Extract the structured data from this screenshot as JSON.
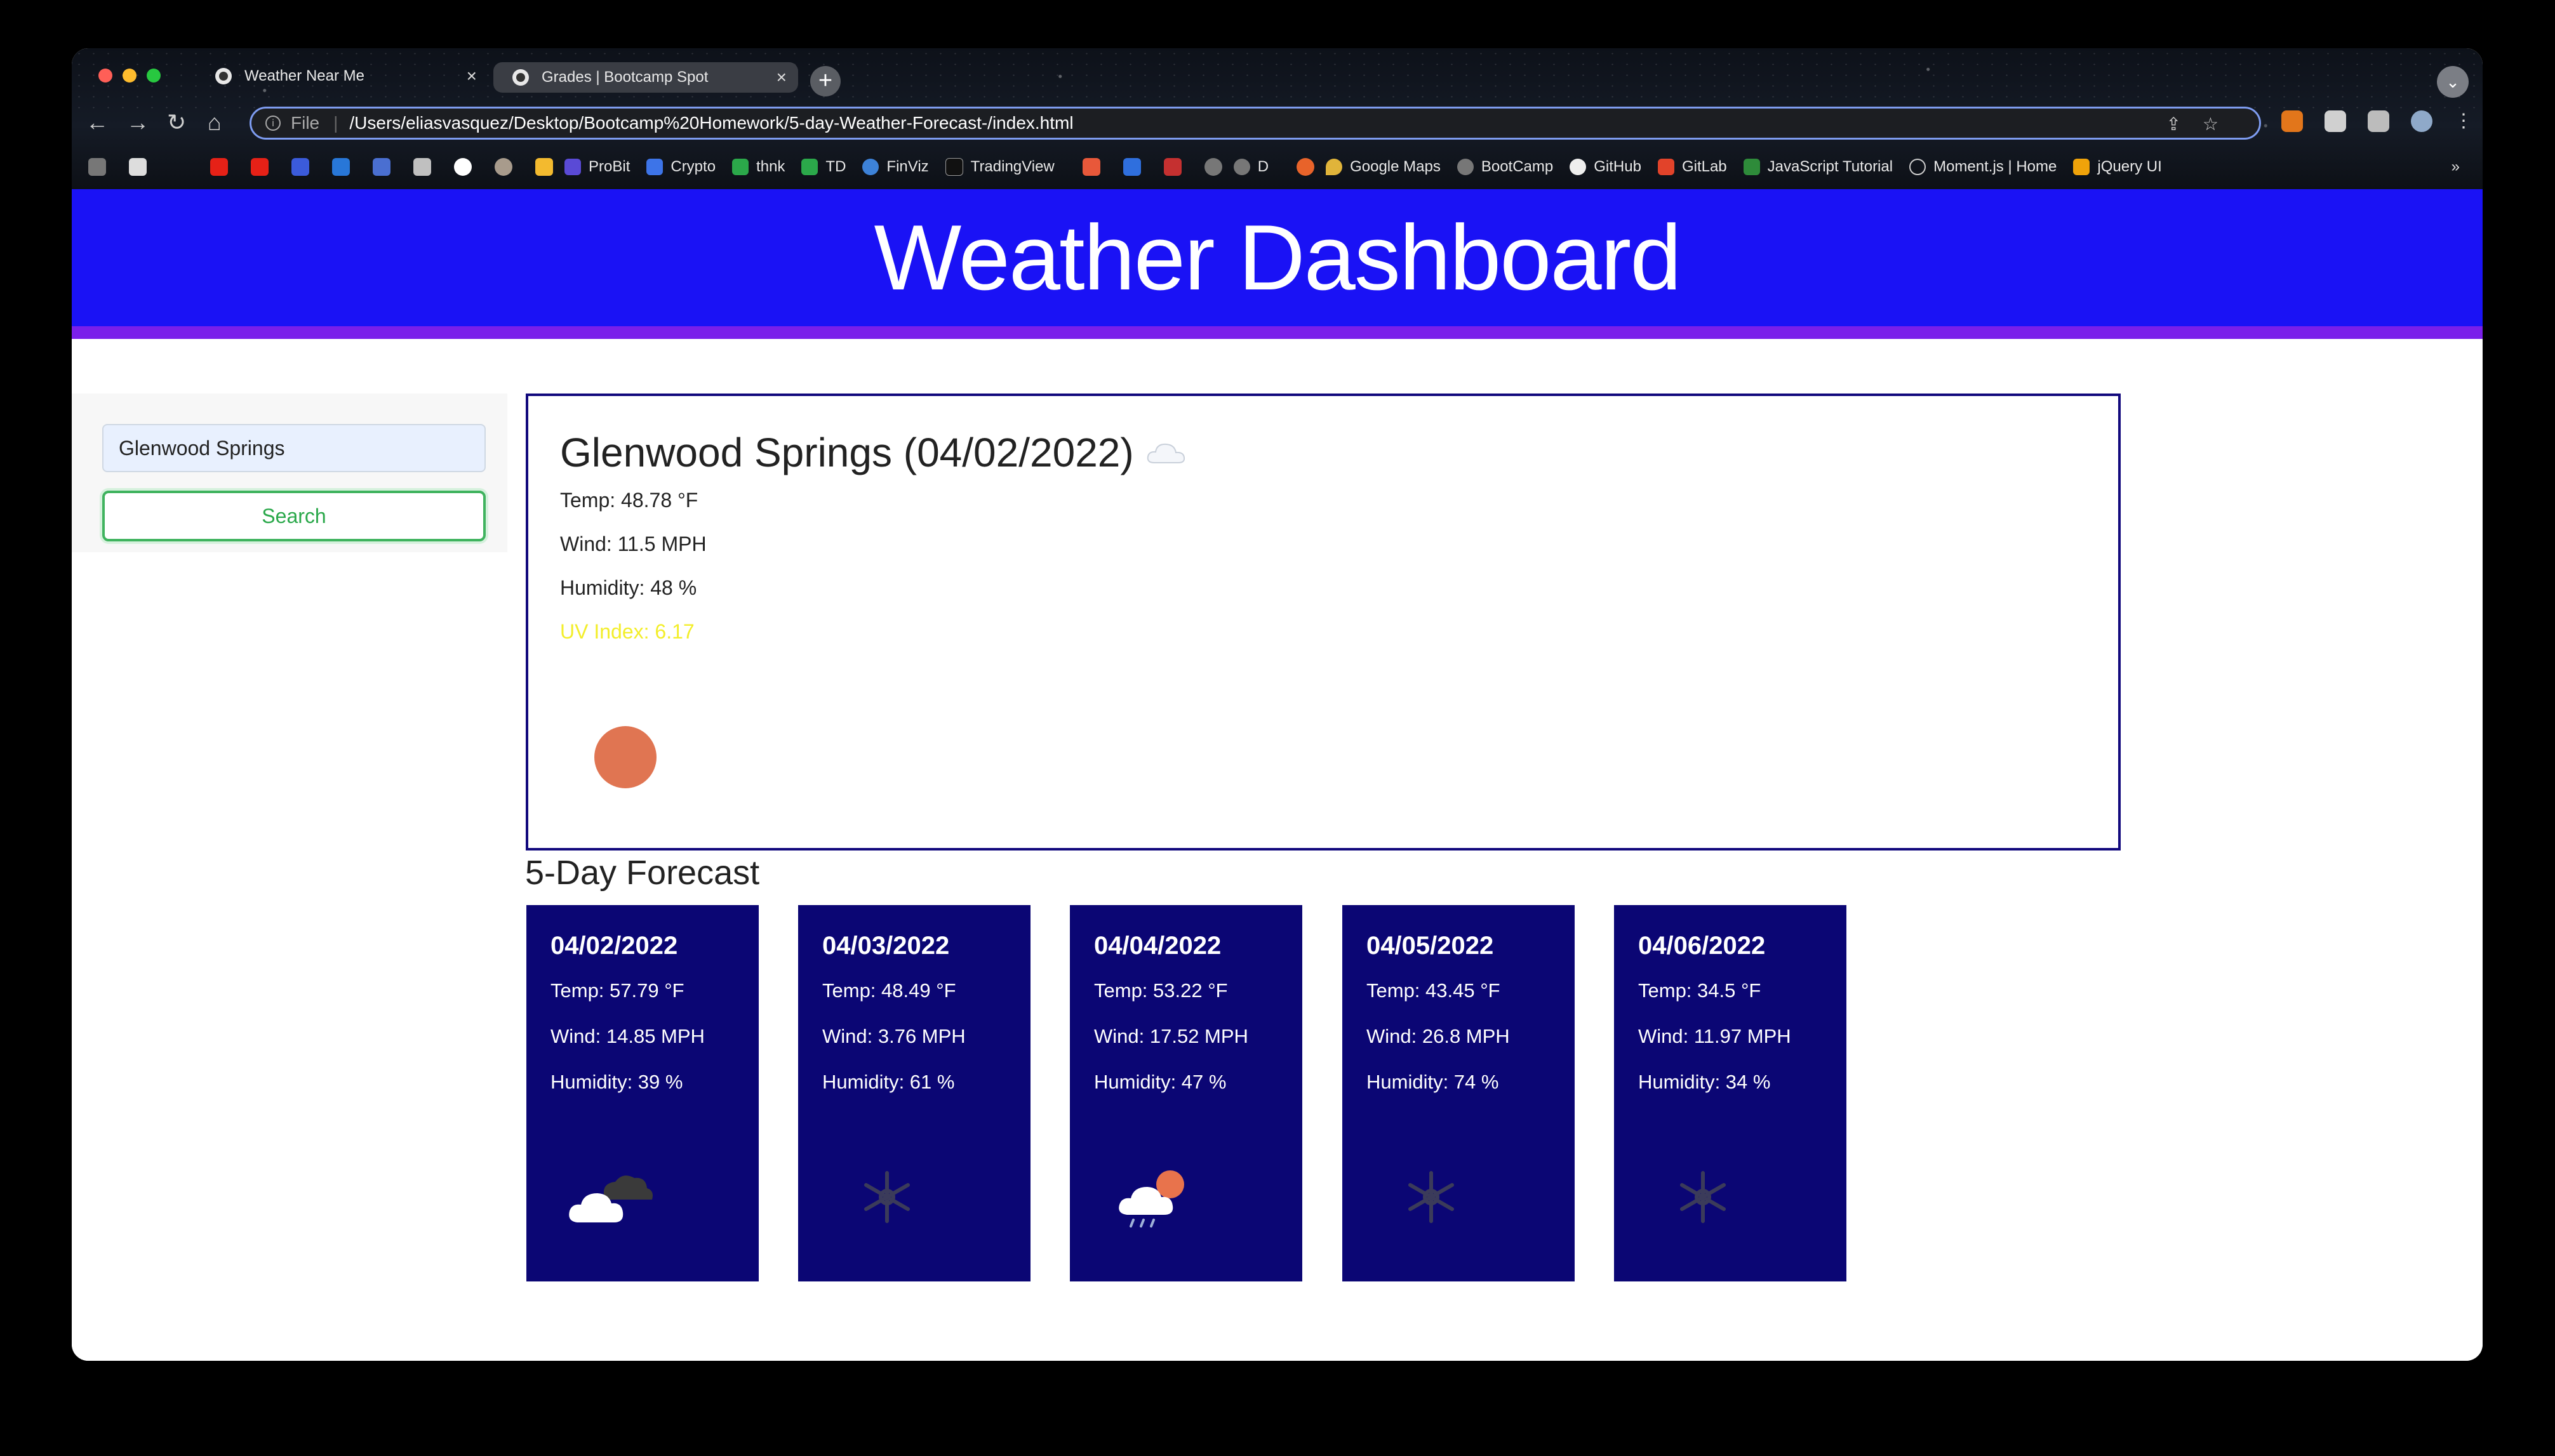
{
  "browser": {
    "tabs": [
      {
        "title": "Weather Near Me"
      },
      {
        "title": "Grades | Bootcamp Spot"
      }
    ],
    "address": {
      "scheme_label": "File",
      "url": "/Users/eliasvasquez/Desktop/Bootcamp%20Homework/5-day-Weather-Forecast-/index.html"
    },
    "bookmarks": [
      "ProBit",
      "Crypto",
      "thnk",
      "TD",
      "FinViz",
      "TradingView",
      "D",
      "Google Maps",
      "BootCamp",
      "GitHub",
      "GitLab",
      "JavaScript Tutorial",
      "Moment.js | Home",
      "jQuery UI"
    ],
    "more_bookmarks": "»"
  },
  "header": {
    "title": "Weather Dashboard"
  },
  "search": {
    "value": "Glenwood Springs",
    "button_label": "Search"
  },
  "current": {
    "title": "Glenwood Springs (04/02/2022)",
    "icon": "cloud-icon",
    "temp": "Temp: 48.78 °F",
    "wind": "Wind: 11.5 MPH",
    "humidity": "Humidity: 48 %",
    "uv": "UV Index: 6.17",
    "uv_color": "#e07552"
  },
  "forecast": {
    "title": "5-Day Forecast",
    "days": [
      {
        "date": "04/02/2022",
        "temp": "Temp: 57.79 °F",
        "wind": "Wind: 14.85 MPH",
        "humidity": "Humidity: 39 %",
        "icon": "broken-clouds-icon"
      },
      {
        "date": "04/03/2022",
        "temp": "Temp: 48.49 °F",
        "wind": "Wind: 3.76 MPH",
        "humidity": "Humidity: 61 %",
        "icon": "snow-icon"
      },
      {
        "date": "04/04/2022",
        "temp": "Temp: 53.22 °F",
        "wind": "Wind: 17.52 MPH",
        "humidity": "Humidity: 47 %",
        "icon": "sun-rain-icon"
      },
      {
        "date": "04/05/2022",
        "temp": "Temp: 43.45 °F",
        "wind": "Wind: 26.8 MPH",
        "humidity": "Humidity: 74 %",
        "icon": "snow-icon"
      },
      {
        "date": "04/06/2022",
        "temp": "Temp: 34.5 °F",
        "wind": "Wind: 11.97 MPH",
        "humidity": "Humidity: 34 %",
        "icon": "snow-icon"
      }
    ]
  },
  "colors": {
    "header_bg": "#1a12f5",
    "header_border": "#7a1fea",
    "card_bg": "#0b0674",
    "uv_text": "#f3ee2a",
    "search_button": "#3fb35e"
  }
}
